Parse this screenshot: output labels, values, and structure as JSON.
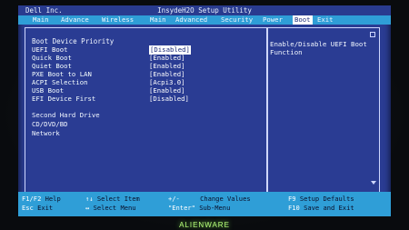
{
  "titlebar": {
    "brand": "Dell Inc.",
    "utility": "InsydeH2O Setup Utility"
  },
  "menu": {
    "items": [
      {
        "label": "Main"
      },
      {
        "label": "Advance"
      },
      {
        "label": "Wireless"
      },
      {
        "label": "Main"
      },
      {
        "label": "Advanced"
      },
      {
        "label": "Security"
      },
      {
        "label": "Power"
      },
      {
        "label": "Boot"
      },
      {
        "label": "Exit"
      }
    ],
    "active": "Boot"
  },
  "main": {
    "section_title": "Boot Device Priority",
    "settings": [
      {
        "label": "UEFI Boot",
        "value": "[Disabled]"
      },
      {
        "label": "Quick Boot",
        "value": "[Enabled]"
      },
      {
        "label": "Quiet Boot",
        "value": "[Enabled]"
      },
      {
        "label": "PXE Boot to LAN",
        "value": "[Enabled]"
      },
      {
        "label": "ACPI Selection",
        "value": "[Acpi3.0]"
      },
      {
        "label": "USB Boot",
        "value": "[Enabled]"
      },
      {
        "label": "EFI Device First",
        "value": "[Disabled]"
      }
    ],
    "boot_order": [
      "Second Hard Drive",
      "CD/DVD/BD",
      "Network"
    ]
  },
  "help": {
    "text": "Enable/Disable UEFI Boot Function"
  },
  "footer": {
    "items": [
      {
        "key": "F1/F2",
        "desc": "Help"
      },
      {
        "key": "↑↓",
        "desc": "Select Item"
      },
      {
        "key": "+/-",
        "desc": "Change Values"
      },
      {
        "key": "F9",
        "desc": "Setup Defaults"
      },
      {
        "key": "Esc",
        "desc": "Exit"
      },
      {
        "key": "↔",
        "desc": "Select Menu"
      },
      {
        "key": "\"Enter\"",
        "desc": "Sub-Menu"
      },
      {
        "key": "F10",
        "desc": "Save and Exit"
      }
    ]
  },
  "bezel": {
    "logo": "ALIENWARE"
  },
  "colors": {
    "background": "#2a3c93",
    "menubar": "#2f9ed7",
    "highlight": "#ffffff",
    "logo_glow": "#b8ff7a"
  }
}
